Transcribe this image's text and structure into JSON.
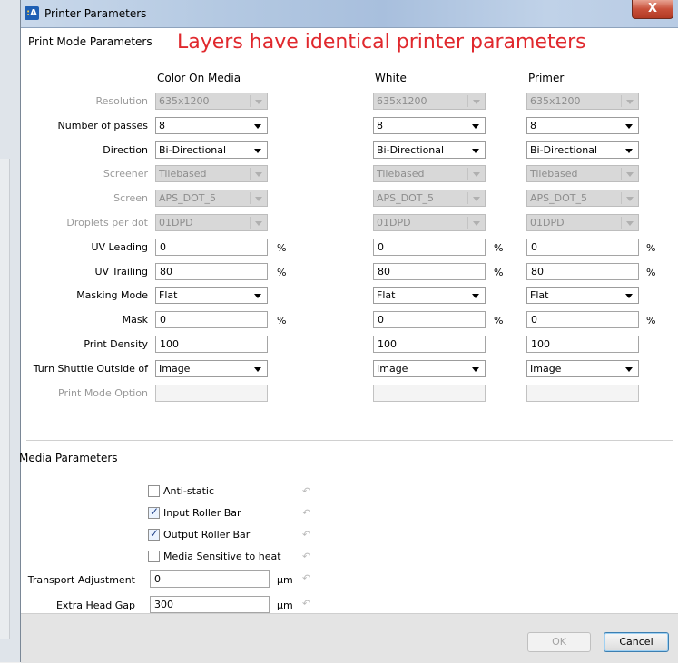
{
  "window": {
    "title": "Printer Parameters",
    "icon_label": "A",
    "close_label": "X"
  },
  "print_mode": {
    "section_title": "Print Mode Parameters",
    "headline": "Layers have identical printer parameters",
    "columns": [
      "Color On Media",
      "White",
      "Primer"
    ],
    "labels": {
      "resolution": "Resolution",
      "passes": "Number of passes",
      "direction": "Direction",
      "screener": "Screener",
      "screen": "Screen",
      "droplets": "Droplets per dot",
      "uv_leading": "UV Leading",
      "uv_trailing": "UV Trailing",
      "masking_mode": "Masking Mode",
      "mask": "Mask",
      "print_density": "Print Density",
      "turn_shuttle": "Turn Shuttle Outside of",
      "print_mode_option": "Print Mode Option"
    },
    "percent": "%",
    "values": {
      "resolution": "635x1200",
      "passes": "8",
      "direction": "Bi-Directional",
      "screener": "Tilebased",
      "screen": "APS_DOT_5",
      "droplets": "01DPD",
      "uv_leading": "0",
      "uv_trailing": "80",
      "masking_mode": "Flat",
      "mask": "0",
      "print_density": "100",
      "turn_shuttle": "Image",
      "print_mode_option": ""
    }
  },
  "media": {
    "section_title": "Media Parameters",
    "checkboxes": [
      {
        "label": "Anti-static",
        "checked": false
      },
      {
        "label": "Input Roller Bar",
        "checked": true
      },
      {
        "label": "Output Roller Bar",
        "checked": true
      },
      {
        "label": "Media Sensitive to heat",
        "checked": false
      }
    ],
    "transport_label": "Transport Adjustment",
    "transport_value": "0",
    "head_gap_label": "Extra Head Gap",
    "head_gap_value": "300",
    "unit": "µm",
    "undo_glyph": "↶",
    "check_glyph": "✓"
  },
  "buttons": {
    "ok": "OK",
    "cancel": "Cancel"
  },
  "colors": {
    "headline": "#e0282d",
    "title_bar": "#b4c9e2",
    "close": "#c8503a"
  }
}
